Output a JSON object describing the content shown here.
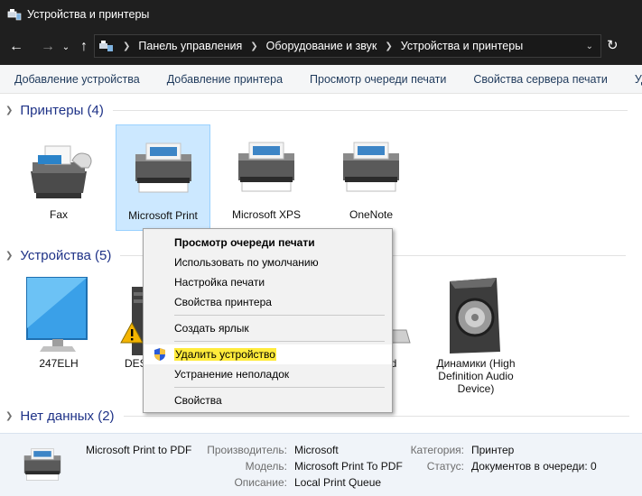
{
  "window": {
    "title": "Устройства и принтеры"
  },
  "address": {
    "back_icon": "arrow-left-icon",
    "forward_icon": "arrow-right-icon",
    "breadcrumb": [
      "Панель управления",
      "Оборудование и звук",
      "Устройства и принтеры"
    ]
  },
  "toolbar": {
    "commands": [
      "Добавление устройства",
      "Добавление принтера",
      "Просмотр очереди печати",
      "Свойства сервера печати",
      "Удалит"
    ]
  },
  "groups": {
    "printers": {
      "header": "Принтеры (4)",
      "items": [
        {
          "label": "Fax",
          "icon": "fax-icon"
        },
        {
          "label": "Microsoft Print",
          "icon": "printer-icon",
          "selected": true
        },
        {
          "label": "Microsoft XPS",
          "icon": "printer-icon"
        },
        {
          "label": "OneNote",
          "icon": "printer-icon"
        }
      ]
    },
    "devices": {
      "header": "Устройства (5)",
      "items": [
        {
          "label": "247ELH",
          "icon": "monitor-icon"
        },
        {
          "label": "DES",
          "icon": "computer-tower-icon",
          "warning": true
        },
        {
          "label": "ard",
          "icon": "keyboard-icon"
        },
        {
          "label": "Динамики (High Definition Audio Device)",
          "icon": "speaker-icon"
        }
      ]
    },
    "nodata": {
      "header": "Нет данных (2)"
    }
  },
  "context_menu": {
    "items": [
      {
        "label": "Просмотр очереди печати",
        "bold": true
      },
      {
        "label": "Использовать по умолчанию"
      },
      {
        "label": "Настройка печати"
      },
      {
        "label": "Свойства принтера"
      },
      {
        "separator": true
      },
      {
        "label": "Создать ярлык"
      },
      {
        "separator": true
      },
      {
        "label": "Удалить устройство",
        "icon": "uac-shield-icon",
        "highlighted": true
      },
      {
        "label": "Устранение неполадок"
      },
      {
        "separator": true
      },
      {
        "label": "Свойства"
      }
    ]
  },
  "details": {
    "name": "Microsoft Print to PDF",
    "manufacturer_label": "Производитель:",
    "manufacturer": "Microsoft",
    "model_label": "Модель:",
    "model": "Microsoft Print To PDF",
    "description_label": "Описание:",
    "description": "Local Print Queue",
    "category_label": "Категория:",
    "category": "Принтер",
    "status_label": "Статус:",
    "status": "Документов в очереди: 0"
  },
  "colors": {
    "title_bar": "#1f1f1f",
    "group_header": "#1e3287",
    "selection": "#cce8ff",
    "highlight": "#ffeb3b"
  }
}
